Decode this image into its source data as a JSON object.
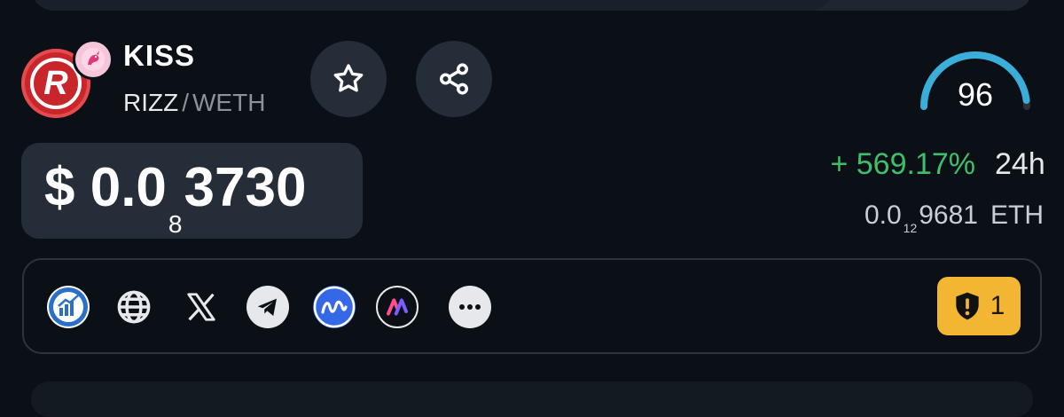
{
  "token": {
    "name": "KISS",
    "logo_letter": "R",
    "base": "RIZZ",
    "separator": "/",
    "quote": "WETH"
  },
  "actions": {
    "star_icon": "star-icon",
    "share_icon": "share-icon"
  },
  "score": {
    "value": "96",
    "level": 0.96
  },
  "price": {
    "currency": "$",
    "lead": "0.0",
    "zeros": "8",
    "digits": "3730"
  },
  "change": {
    "text": "+ 569.17%",
    "period": "24h"
  },
  "eth_price": {
    "lead": "0.0",
    "zeros": "12",
    "digits": "9681",
    "unit": "ETH"
  },
  "links": [
    {
      "name": "chart-icon"
    },
    {
      "name": "globe-icon"
    },
    {
      "name": "x-icon"
    },
    {
      "name": "telegram-icon"
    },
    {
      "name": "coinmarketcap-icon"
    },
    {
      "name": "app-icon"
    },
    {
      "name": "more-icon"
    }
  ],
  "audit": {
    "count": "1"
  },
  "colors": {
    "background": "#0b0f16",
    "card": "#252d38",
    "positive": "#3fbf6b",
    "warning": "#f2b632",
    "gauge": "#3aaed8"
  }
}
